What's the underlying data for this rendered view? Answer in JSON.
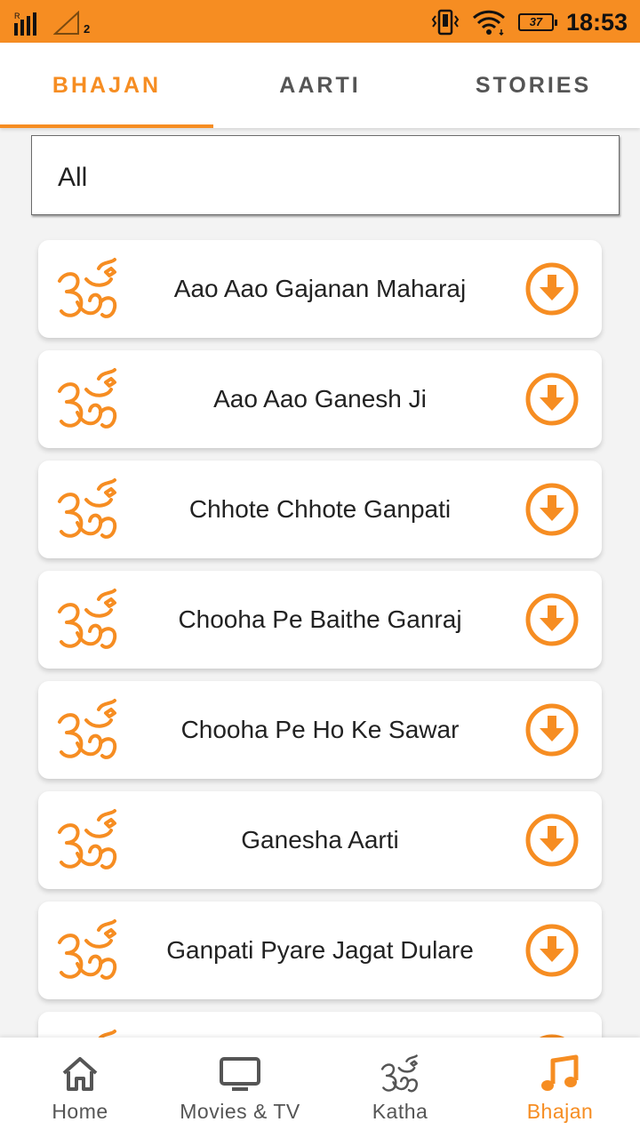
{
  "status_bar": {
    "time": "18:53",
    "battery": "37",
    "sim_slot": "2",
    "network_label": "R"
  },
  "tabs": [
    {
      "label": "BHAJAN",
      "active": true
    },
    {
      "label": "AARTI",
      "active": false
    },
    {
      "label": "STORIES",
      "active": false
    }
  ],
  "filter": {
    "value": "All"
  },
  "items": [
    {
      "title": "Aao Aao Gajanan Maharaj"
    },
    {
      "title": "Aao Aao Ganesh Ji"
    },
    {
      "title": "Chhote Chhote Ganpati"
    },
    {
      "title": "Chooha Pe Baithe Ganraj"
    },
    {
      "title": "Chooha Pe Ho Ke Sawar"
    },
    {
      "title": "Ganesha Aarti"
    },
    {
      "title": "Ganpati Pyare Jagat Dulare"
    }
  ],
  "bottom_nav": [
    {
      "label": "Home",
      "icon": "home-icon",
      "active": false
    },
    {
      "label": "Movies & TV",
      "icon": "tv-icon",
      "active": false
    },
    {
      "label": "Katha",
      "icon": "om-icon",
      "active": false
    },
    {
      "label": "Bhajan",
      "icon": "music-note-icon",
      "active": true
    }
  ],
  "colors": {
    "accent": "#f68d22",
    "background": "#f3f3f3",
    "card": "#ffffff",
    "text": "#222222",
    "inactive": "#555555"
  }
}
